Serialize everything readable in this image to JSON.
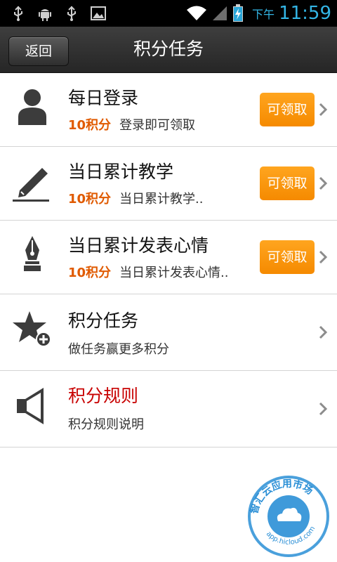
{
  "status_bar": {
    "icons": [
      "usb-icon",
      "android-debug-icon",
      "usb-icon",
      "image-icon",
      "wifi-icon",
      "signal-icon",
      "battery-charging-icon"
    ],
    "ampm": "下午",
    "time": "11:59"
  },
  "header": {
    "back_label": "返回",
    "title": "积分任务"
  },
  "tasks": [
    {
      "icon": "user-icon",
      "title": "每日登录",
      "points": "10积分",
      "desc": "登录即可领取",
      "button": "可领取"
    },
    {
      "icon": "pencil-icon",
      "title": "当日累计教学",
      "points": "10积分",
      "desc": "当日累计教学..",
      "button": "可领取"
    },
    {
      "icon": "fountain-pen-icon",
      "title": "当日累计发表心情",
      "points": "10积分",
      "desc": "当日累计发表心情..",
      "button": "可领取"
    }
  ],
  "links": [
    {
      "icon": "star-add-icon",
      "title": "积分任务",
      "desc": "做任务赢更多积分"
    },
    {
      "icon": "speaker-icon",
      "title": "积分规则",
      "desc": "积分规则说明"
    }
  ],
  "watermark": {
    "text": "智汇云应用市场",
    "url": "app.hicloud.com",
    "color": "#2a8fd6"
  },
  "colors": {
    "accent_orange": "#f58a00",
    "points_orange": "#e05a00",
    "rule_red": "#c80000",
    "clock_blue": "#33b5e5"
  }
}
